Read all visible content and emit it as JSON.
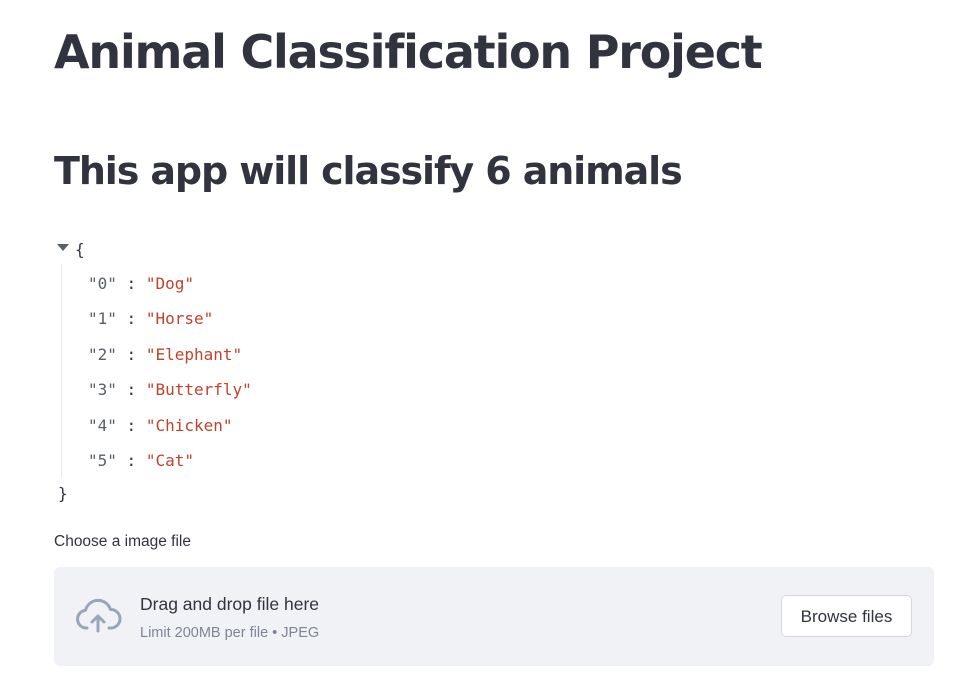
{
  "page": {
    "title": "Animal Classification Project",
    "subheader": "This app will classify 6 animals"
  },
  "json_viewer": {
    "open_brace": "{",
    "close_brace": "}",
    "entries": [
      {
        "key": "\"0\"",
        "value": "\"Dog\""
      },
      {
        "key": "\"1\"",
        "value": "\"Horse\""
      },
      {
        "key": "\"2\"",
        "value": "\"Elephant\""
      },
      {
        "key": "\"3\"",
        "value": "\"Butterfly\""
      },
      {
        "key": "\"4\"",
        "value": "\"Chicken\""
      },
      {
        "key": "\"5\"",
        "value": "\"Cat\""
      }
    ],
    "separator": ":"
  },
  "uploader": {
    "label": "Choose a image file",
    "dropzone_title": "Drag and drop file here",
    "dropzone_hint": "Limit 200MB per file • JPEG",
    "browse_label": "Browse files",
    "icon": "cloud-upload-icon"
  },
  "colors": {
    "text": "#31333f",
    "json_value": "#c0432c",
    "dropzone_bg": "#f0f2f6",
    "hint": "#808495"
  }
}
